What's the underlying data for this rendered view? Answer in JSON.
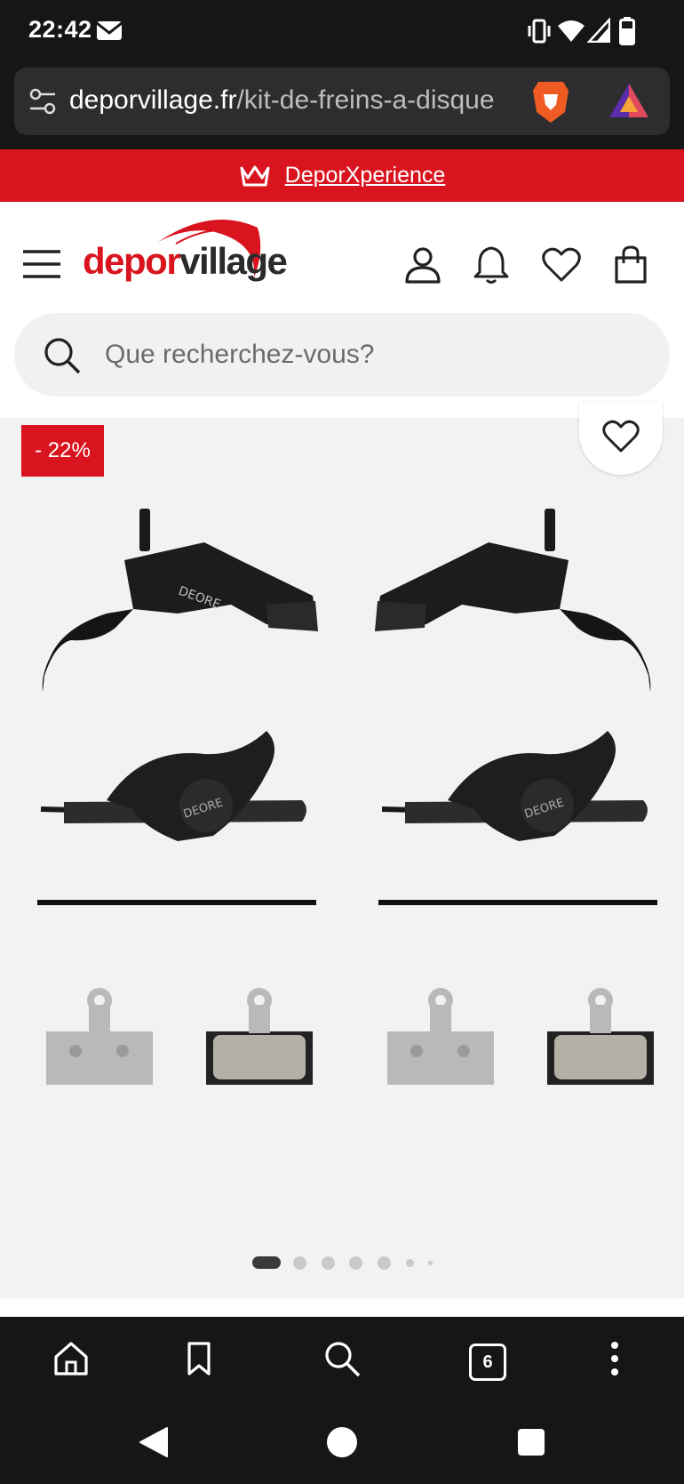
{
  "status_bar": {
    "time": "22:42"
  },
  "browser": {
    "url_domain": "deporvillage.fr",
    "url_path": "/kit-de-freins-a-disque"
  },
  "promo": {
    "link_text": "DeporXperience"
  },
  "brand": {
    "name_part1": "depor",
    "name_part2": "village",
    "red": "#d9141f",
    "dark": "#2a2a2a"
  },
  "search": {
    "placeholder": "Que recherchez-vous?"
  },
  "product": {
    "discount_badge": "- 22%"
  },
  "carousel": {
    "current_index": 1
  },
  "bottom_nav": {
    "tab_count": "6"
  },
  "icons": [
    "mail-icon",
    "vibrate-icon",
    "wifi-icon",
    "signal-icon",
    "battery-icon",
    "site-settings-icon",
    "brave-lion-icon",
    "rewards-triangle-icon",
    "crown-icon",
    "menu-icon",
    "account-icon",
    "bell-icon",
    "heart-icon",
    "bag-icon",
    "search-icon",
    "home-icon",
    "bookmark-icon",
    "tabs-icon",
    "more-icon",
    "back-icon",
    "home-circle-icon",
    "recents-icon"
  ]
}
